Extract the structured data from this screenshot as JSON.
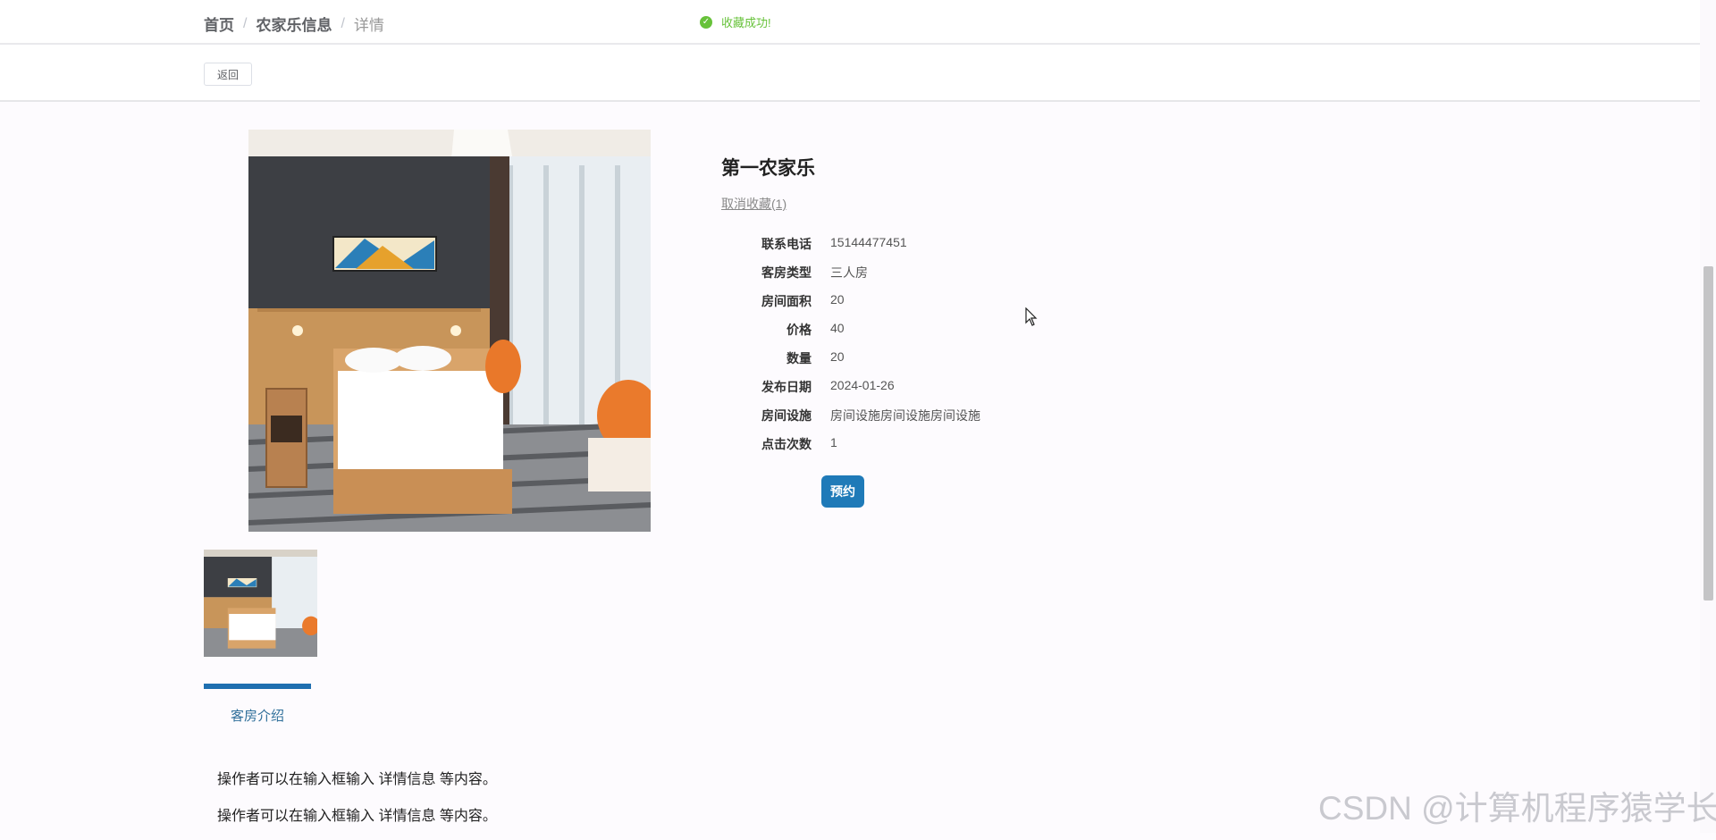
{
  "breadcrumb": {
    "home": "首页",
    "list": "农家乐信息",
    "current": "详情",
    "separator": "/"
  },
  "toast": {
    "message": "收藏成功!"
  },
  "actions": {
    "back_label": "返回"
  },
  "detail": {
    "title": "第一农家乐",
    "unfavorite_label": "取消收藏(1)",
    "fields": [
      {
        "label": "联系电话",
        "value": "15144477451"
      },
      {
        "label": "客房类型",
        "value": "三人房"
      },
      {
        "label": "房间面积",
        "value": "20"
      },
      {
        "label": "价格",
        "value": "40"
      },
      {
        "label": "数量",
        "value": "20"
      },
      {
        "label": "发布日期",
        "value": "2024-01-26"
      },
      {
        "label": "房间设施",
        "value": "房间设施房间设施房间设施"
      },
      {
        "label": "点击次数",
        "value": "1"
      }
    ],
    "book_label": "预约"
  },
  "tabs": [
    {
      "label": "客房介绍"
    }
  ],
  "intro": {
    "lines": [
      "操作者可以在输入框输入  详情信息  等内容。",
      "操作者可以在输入框输入  详情信息  等内容。"
    ]
  },
  "watermark": "CSDN @计算机程序猿学长",
  "colors": {
    "accent": "#1f7ab8",
    "success": "#67c23a",
    "tab_underline": "#1f6fb0"
  },
  "icons": {
    "toast": "check-circle-icon",
    "pointer": "cursor-arrow-icon"
  }
}
